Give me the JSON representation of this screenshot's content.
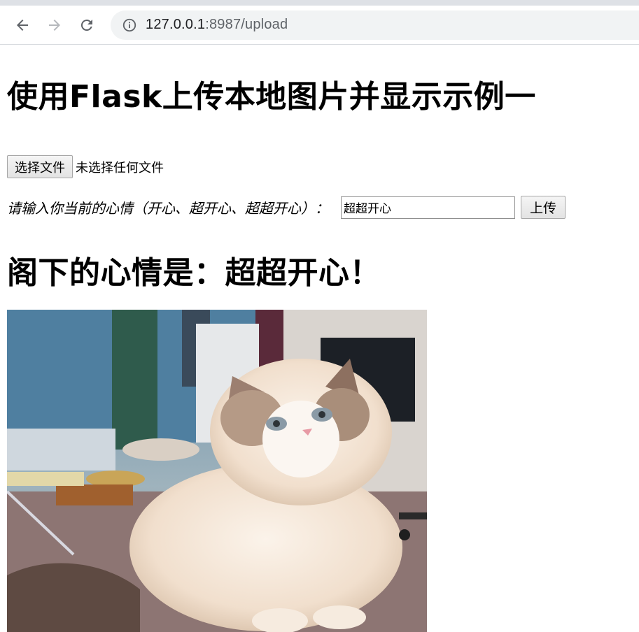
{
  "browser": {
    "url_host": "127.0.0.1",
    "url_rest": ":8987/upload",
    "icons": {
      "back": "arrow-left-icon",
      "forward": "arrow-right-icon",
      "reload": "reload-icon",
      "info": "info-icon"
    }
  },
  "page": {
    "title": "使用Flask上传本地图片并显示示例一",
    "file_button_label": "选择文件",
    "file_status": "未选择任何文件",
    "mood_label": "请输入你当前的心情（开心、超开心、超超开心）：",
    "mood_value": "超超开心",
    "upload_button_label": "上传",
    "result_heading": "阁下的心情是：超超开心！"
  },
  "colors": {
    "chrome_top": "#dee1e6",
    "omnibox_bg": "#f1f3f4",
    "url_host": "#202124",
    "url_rest": "#5f6368"
  }
}
